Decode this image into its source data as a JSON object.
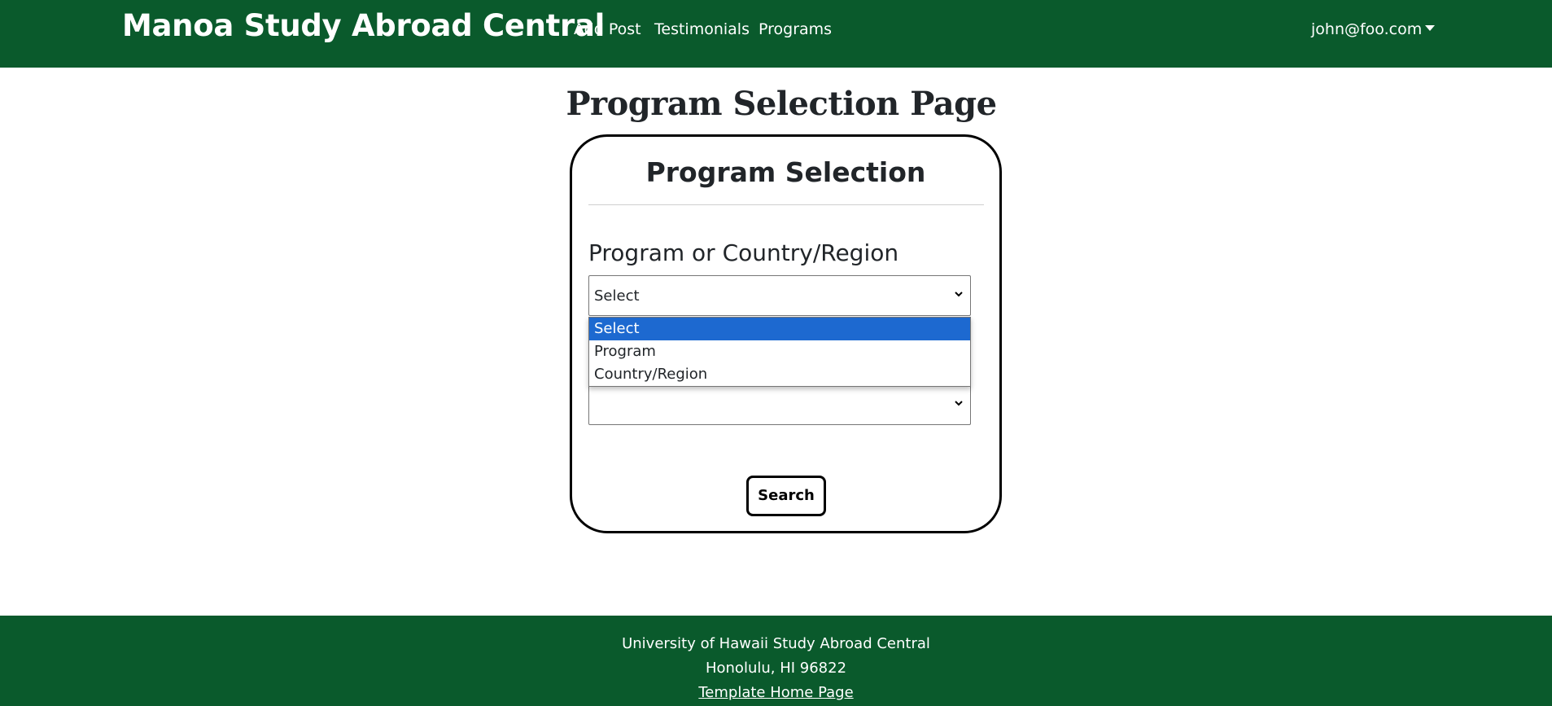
{
  "navbar": {
    "brand": "Manoa Study Abroad Central",
    "links": [
      "Add Post",
      "Testimonials",
      "Programs"
    ],
    "user": "john@foo.com",
    "background_color": "#0a5a2c"
  },
  "page": {
    "title": "Program Selection Page"
  },
  "card": {
    "title": "Program Selection",
    "field_label": "Program or Country/Region",
    "select": {
      "value": "Select",
      "options": [
        "Select",
        "Program",
        "Country/Region"
      ],
      "highlighted_option": "Select",
      "highlight_color": "#1d69d0"
    },
    "second_select": {
      "value": ""
    },
    "search_button": "Search"
  },
  "footer": {
    "line1": "University of Hawaii Study Abroad Central",
    "line2": "Honolulu, HI 96822",
    "link": "Template Home Page"
  }
}
